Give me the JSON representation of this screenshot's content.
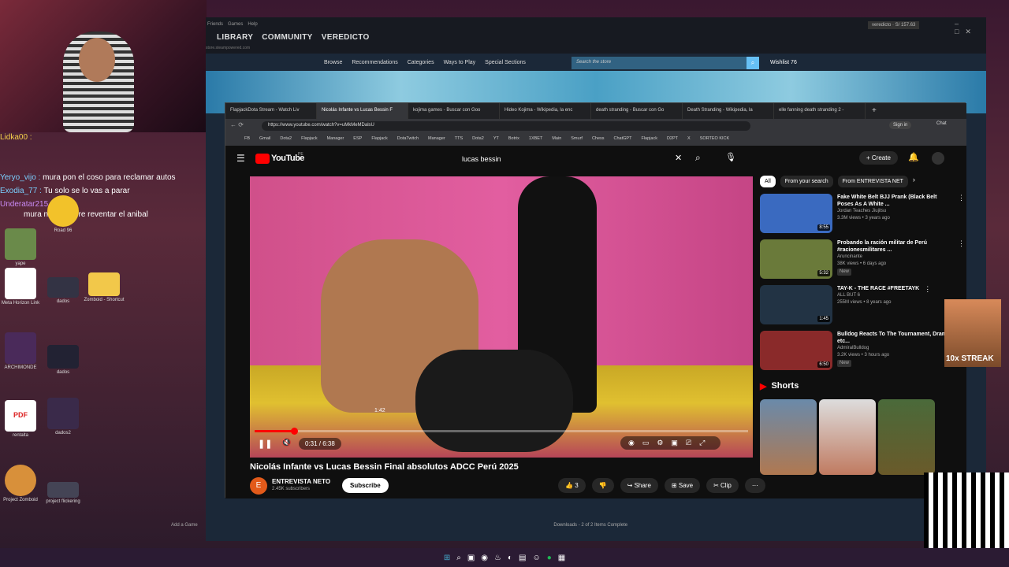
{
  "chat": [
    {
      "user": "Lidka00 :",
      "msg": "",
      "cls": "u1"
    },
    {
      "user": "Yeryo_vijo :",
      "msg": "mura pon el coso para reclamar autos",
      "cls": "u2"
    },
    {
      "user": "Exodia_77 :",
      "msg": "Tu solo se lo vas a parar",
      "cls": "u2"
    },
    {
      "user": "Underatar215 :",
      "msg": "",
      "cls": "u3"
    },
    {
      "user": "",
      "msg": "mura no te quiere reventar el anibal",
      "cls": "u3"
    }
  ],
  "desktop_icons": [
    "yape",
    "Road 96",
    "Meta Horizon Link",
    "dados",
    "Zomboid - Shortcut",
    "ARCHIMONDE",
    "dados",
    "rentalta",
    "dados2",
    "Project Zomboid",
    "project flickering"
  ],
  "steam": {
    "menu": [
      "Friends",
      "Games",
      "Help"
    ],
    "nav": [
      "LIBRARY",
      "COMMUNITY",
      "VEREDICTO"
    ],
    "url": "store.steampowered.com",
    "user": "veredicto · S/ 157.63",
    "storebar": [
      "Browse",
      "Recommendations",
      "Categories",
      "Ways to Play",
      "Special Sections"
    ],
    "search_placeholder": "Search the store",
    "wishlist": "Wishlist 76",
    "add_game": "Add a Game",
    "downloads": "Downloads - 2 of 2 Items Complete"
  },
  "browser": {
    "tabs": [
      "FlapjackDota Stream - Watch Liv",
      "Nicolás Infante vs Lucas Bessin F",
      "kojima games - Buscar con Goo",
      "Hideo Kojima - Wikipedia, la enc",
      "death stranding - Buscar con Go",
      "Death Stranding - Wikipedia, la",
      "elle fanning death stranding 2 -"
    ],
    "url": "https://www.youtube.com/watch?v=uMkMeMDalsU",
    "bookmarks": [
      "FB",
      "Gmail",
      "Dota2",
      "Flapjack",
      "Manager",
      "ESP",
      "Flapjack",
      "DotaTwitch",
      "Manager",
      "TTS",
      "Dota2",
      "YT",
      "Botrix",
      "1XBET",
      "Main",
      "Smurf",
      "Chess",
      "ChatGPT",
      "Flapjack",
      "D2PT",
      "X",
      "SORTEO KICK"
    ],
    "sign_in": "Sign in",
    "chat": "Chat"
  },
  "youtube": {
    "logo": "YouTube",
    "logo_region": "PE",
    "search_value": "lucas bessin",
    "create": "Create",
    "hover_time": "1:42",
    "time": "0:31 / 6:38",
    "progress_fraction": 0.08,
    "title": "Nicolás Infante vs Lucas Bessin Final absolutos ADCC Perú 2025",
    "channel": "ENTREVISTA NETO",
    "channel_initial": "E",
    "subscribers": "2.45K subscribers",
    "subscribe": "Subscribe",
    "likes": "3",
    "share": "Share",
    "save": "Save",
    "clip": "Clip",
    "chips": [
      "All",
      "From your search",
      "From ENTREVISTA NET"
    ],
    "recs": [
      {
        "title": "Fake White Belt BJJ Prank (Black Belt Poses As A White ...",
        "channel": "Jordan Teaches Jiujitsu",
        "meta": "3.3M views • 3 years ago",
        "dur": "8:55",
        "badge": "",
        "color": "#3a6ac0"
      },
      {
        "title": "Probando la ración militar de Perú #racionesmilitares ...",
        "channel": "Aruncinante",
        "meta": "38K views • 6 days ago",
        "dur": "5:32",
        "badge": "New",
        "color": "#6a7a3a"
      },
      {
        "title": "TAY-K - THE RACE #FREETAYK",
        "channel": "ALL BUT 6",
        "meta": "255M views • 8 years ago",
        "dur": "1:45",
        "badge": "",
        "color": "#223344"
      },
      {
        "title": "Bulldog Reacts To The Tournament, Drama etc...",
        "channel": "AdmiralBulldog",
        "meta": "3.2K views • 3 hours ago",
        "dur": "6:50",
        "badge": "New",
        "color": "#8a2a2a"
      }
    ],
    "shorts_label": "Shorts"
  },
  "overlay": {
    "streak": "10x STREAK"
  }
}
